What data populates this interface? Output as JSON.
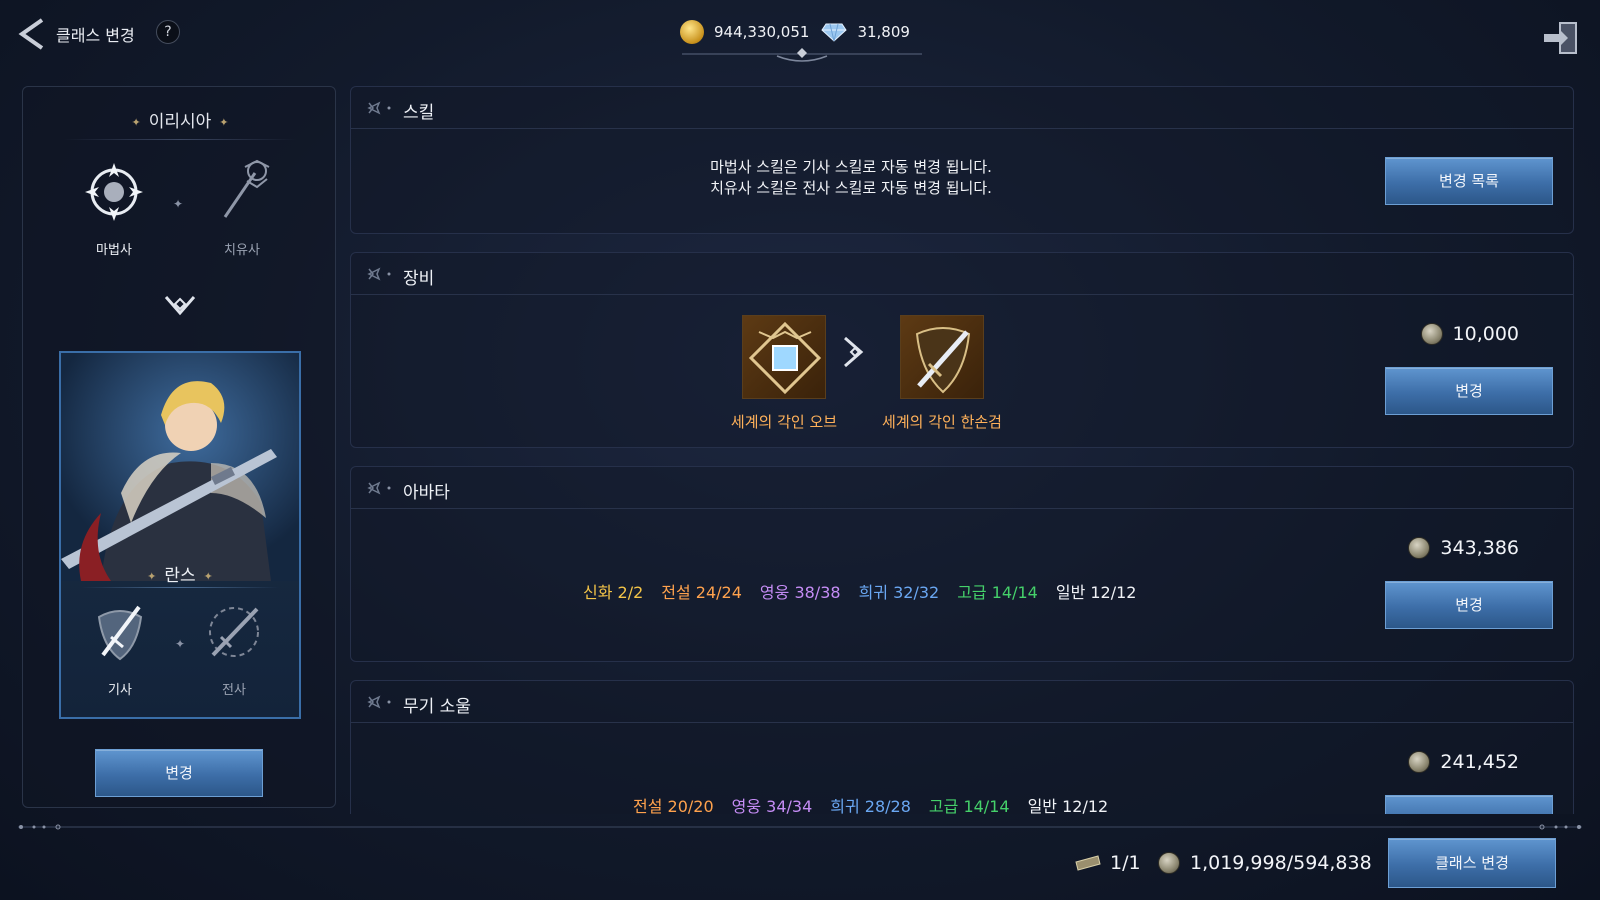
{
  "header": {
    "title": "클래스 변경",
    "help": "?",
    "gold": "944,330,051",
    "gems": "31,809"
  },
  "left": {
    "race": "이리시아",
    "from_classes": [
      {
        "label": "마법사",
        "icon": "mage-emblem-icon"
      },
      {
        "label": "치유사",
        "icon": "healer-staff-icon"
      }
    ],
    "character_name": "란스",
    "to_classes": [
      {
        "label": "기사",
        "icon": "knight-emblem-icon"
      },
      {
        "label": "전사",
        "icon": "warrior-sword-icon"
      }
    ],
    "change_label": "변경"
  },
  "sections": {
    "skill": {
      "title": "스킬",
      "line1": "마법사 스킬은 기사 스킬로 자동 변경 됩니다.",
      "line2": "치유사 스킬은 전사 스킬로 자동 변경 됩니다.",
      "button": "변경 목록"
    },
    "equipment": {
      "title": "장비",
      "from_item": "세계의 각인 오브",
      "to_item": "세계의 각인 한손검",
      "price": "10,000",
      "button": "변경"
    },
    "avatar": {
      "title": "아바타",
      "grades": [
        {
          "label": "신화 2/2",
          "color": "#f3c448"
        },
        {
          "label": "전설 24/24",
          "color": "#ffa24d"
        },
        {
          "label": "영웅 38/38",
          "color": "#c58cf5"
        },
        {
          "label": "희귀 32/32",
          "color": "#6aa7f2"
        },
        {
          "label": "고급 14/14",
          "color": "#45d16a"
        },
        {
          "label": "일반 12/12",
          "color": "#f0f2f6"
        }
      ],
      "price": "343,386",
      "button": "변경"
    },
    "weapon_soul": {
      "title": "무기 소울",
      "grades": [
        {
          "label": "전설 20/20",
          "color": "#ffa24d"
        },
        {
          "label": "영웅 34/34",
          "color": "#c58cf5"
        },
        {
          "label": "희귀 28/28",
          "color": "#6aa7f2"
        },
        {
          "label": "고급 14/14",
          "color": "#45d16a"
        },
        {
          "label": "일반 12/12",
          "color": "#f0f2f6"
        }
      ],
      "price": "241,452"
    }
  },
  "footer": {
    "tickets": "1/1",
    "cost": "1,019,998/594,838",
    "class_change_label": "클래스 변경"
  }
}
